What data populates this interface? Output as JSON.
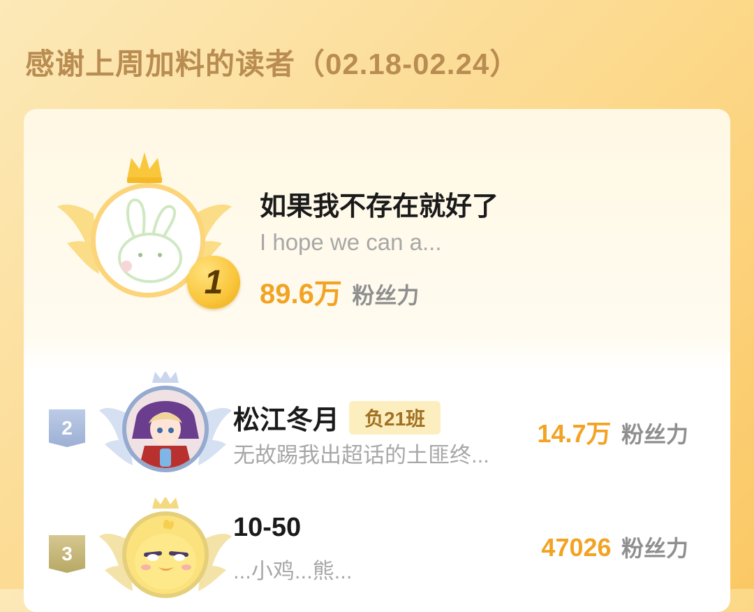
{
  "header": {
    "title": "感谢上周加料的读者（02.18-02.24）"
  },
  "colors": {
    "accent": "#f2a323",
    "title": "#b98c52",
    "badge_bg": "#fdeec0"
  },
  "top_reader": {
    "rank": "1",
    "name": "如果我不存在就好了",
    "description": "I hope we can a...",
    "score": "89.6万",
    "score_unit": "粉丝力",
    "avatar_icon": "rabbit-avatar-icon"
  },
  "readers": [
    {
      "rank": "2",
      "name": "松江冬月",
      "badge": "负21班",
      "description": "无故踢我出超话的土匪终...",
      "score": "14.7万",
      "score_unit": "粉丝力",
      "avatar_icon": "anime-girl-avatar-icon"
    },
    {
      "rank": "3",
      "name": "10-50",
      "description": "...小鸡...熊...",
      "score": "47026",
      "score_unit": "粉丝力",
      "avatar_icon": "yellow-chick-avatar-icon"
    }
  ]
}
